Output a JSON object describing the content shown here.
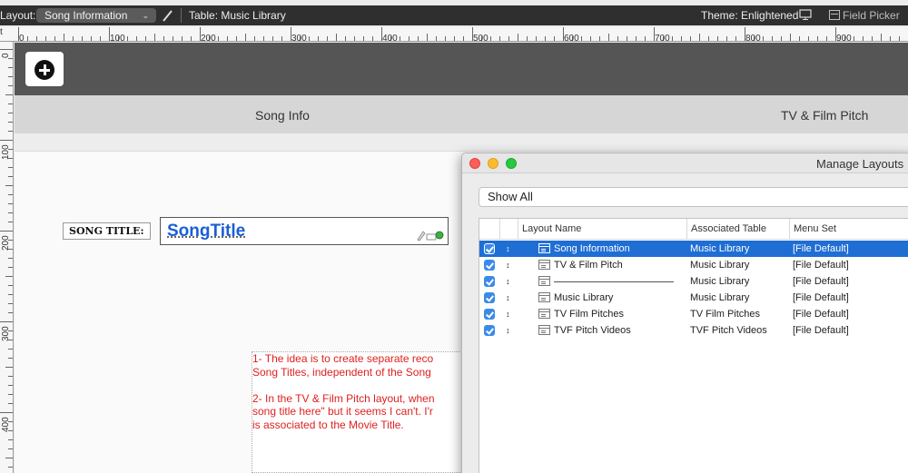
{
  "layout_bar": {
    "layout_label": "Layout:",
    "layout_value": "Song Information",
    "table_label": "Table: Music Library",
    "theme_label": "Theme: Enlightened",
    "field_picker_label": "Field Picker"
  },
  "rulers": {
    "corner": "t",
    "top_numbers": [
      "0",
      "100",
      "200",
      "300",
      "400",
      "500",
      "600",
      "700",
      "800",
      "900"
    ],
    "left_numbers": [
      "0",
      "100",
      "200",
      "300",
      "400"
    ]
  },
  "canvas": {
    "nav_tabs": [
      "Song Info",
      "TV & Film Pitch"
    ],
    "song_title_label": "SONG TITLE:",
    "song_title_value": "SongTitle",
    "note_lines": [
      "1- The idea is to create separate reco",
      "Song Titles, independent of the Song",
      "",
      "2- In the TV & Film Pitch layout, when",
      "song title here\" but it seems I can't. I'r",
      "is associated to the Movie Title."
    ]
  },
  "dialog": {
    "title": "Manage Layouts",
    "filter_value": "Show All",
    "columns": [
      "Layout Name",
      "Associated Table",
      "Menu Set"
    ],
    "rows": [
      {
        "name": "Song Information",
        "table": "Music Library",
        "menu": "[File Default]",
        "selected": true
      },
      {
        "name": "TV & Film Pitch",
        "table": "Music Library",
        "menu": "[File Default]",
        "selected": false
      },
      {
        "name": "",
        "table": "Music Library",
        "menu": "[File Default]",
        "selected": false,
        "divider": true
      },
      {
        "name": "Music Library",
        "table": "Music Library",
        "menu": "[File Default]",
        "selected": false
      },
      {
        "name": "TV Film Pitches",
        "table": "TV Film Pitches",
        "menu": "[File Default]",
        "selected": false
      },
      {
        "name": "TVF Pitch Videos",
        "table": "TVF Pitch Videos",
        "menu": "[File Default]",
        "selected": false
      }
    ]
  },
  "colors": {
    "accent": "#1f6ed4",
    "note_text": "#e02020",
    "song_title": "#1a5fd6",
    "close_button": "#fc5f57",
    "minimize_button": "#fdbc2e",
    "zoom_button": "#28c840"
  }
}
